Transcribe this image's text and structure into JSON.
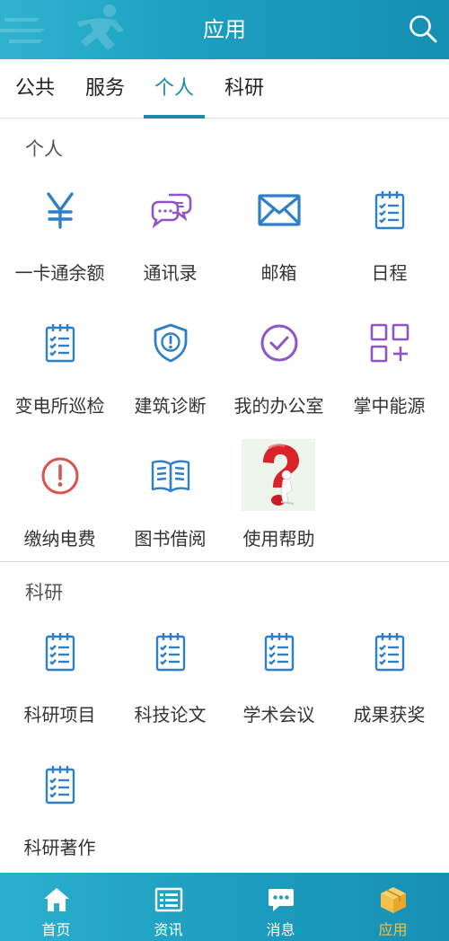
{
  "header": {
    "title": "应用"
  },
  "tabs": [
    {
      "label": "公共"
    },
    {
      "label": "服务"
    },
    {
      "label": "个人"
    },
    {
      "label": "科研"
    }
  ],
  "active_tab": "个人",
  "sections": {
    "personal": {
      "title": "个人",
      "items": [
        {
          "label": "一卡通余额",
          "icon": "yen-icon"
        },
        {
          "label": "通讯录",
          "icon": "chat-bubbles-icon"
        },
        {
          "label": "邮箱",
          "icon": "mail-icon"
        },
        {
          "label": "日程",
          "icon": "notepad-icon"
        },
        {
          "label": "变电所巡检",
          "icon": "notepad-icon"
        },
        {
          "label": "建筑诊断",
          "icon": "shield-alert-icon"
        },
        {
          "label": "我的办公室",
          "icon": "check-circle-icon"
        },
        {
          "label": "掌中能源",
          "icon": "grid-plus-icon"
        },
        {
          "label": "缴纳电费",
          "icon": "alert-circle-icon"
        },
        {
          "label": "图书借阅",
          "icon": "open-book-icon"
        },
        {
          "label": "使用帮助",
          "icon": "question-mark-image"
        }
      ]
    },
    "research": {
      "title": "科研",
      "items": [
        {
          "label": "科研项目",
          "icon": "notepad-icon"
        },
        {
          "label": "科技论文",
          "icon": "notepad-icon"
        },
        {
          "label": "学术会议",
          "icon": "notepad-icon"
        },
        {
          "label": "成果获奖",
          "icon": "notepad-icon"
        },
        {
          "label": "科研著作",
          "icon": "notepad-icon"
        }
      ]
    }
  },
  "bottom_nav": [
    {
      "label": "首页",
      "icon": "home-icon"
    },
    {
      "label": "资讯",
      "icon": "news-icon"
    },
    {
      "label": "消息",
      "icon": "message-icon"
    },
    {
      "label": "应用",
      "icon": "cube-icon"
    }
  ],
  "colors": {
    "header": "#1a9fc0",
    "tab_active": "#1b8ba6",
    "icon_blue": "#2f7fc8",
    "icon_purple": "#8e56c4",
    "icon_red": "#d9534f",
    "nav_active": "#f4c04a"
  }
}
